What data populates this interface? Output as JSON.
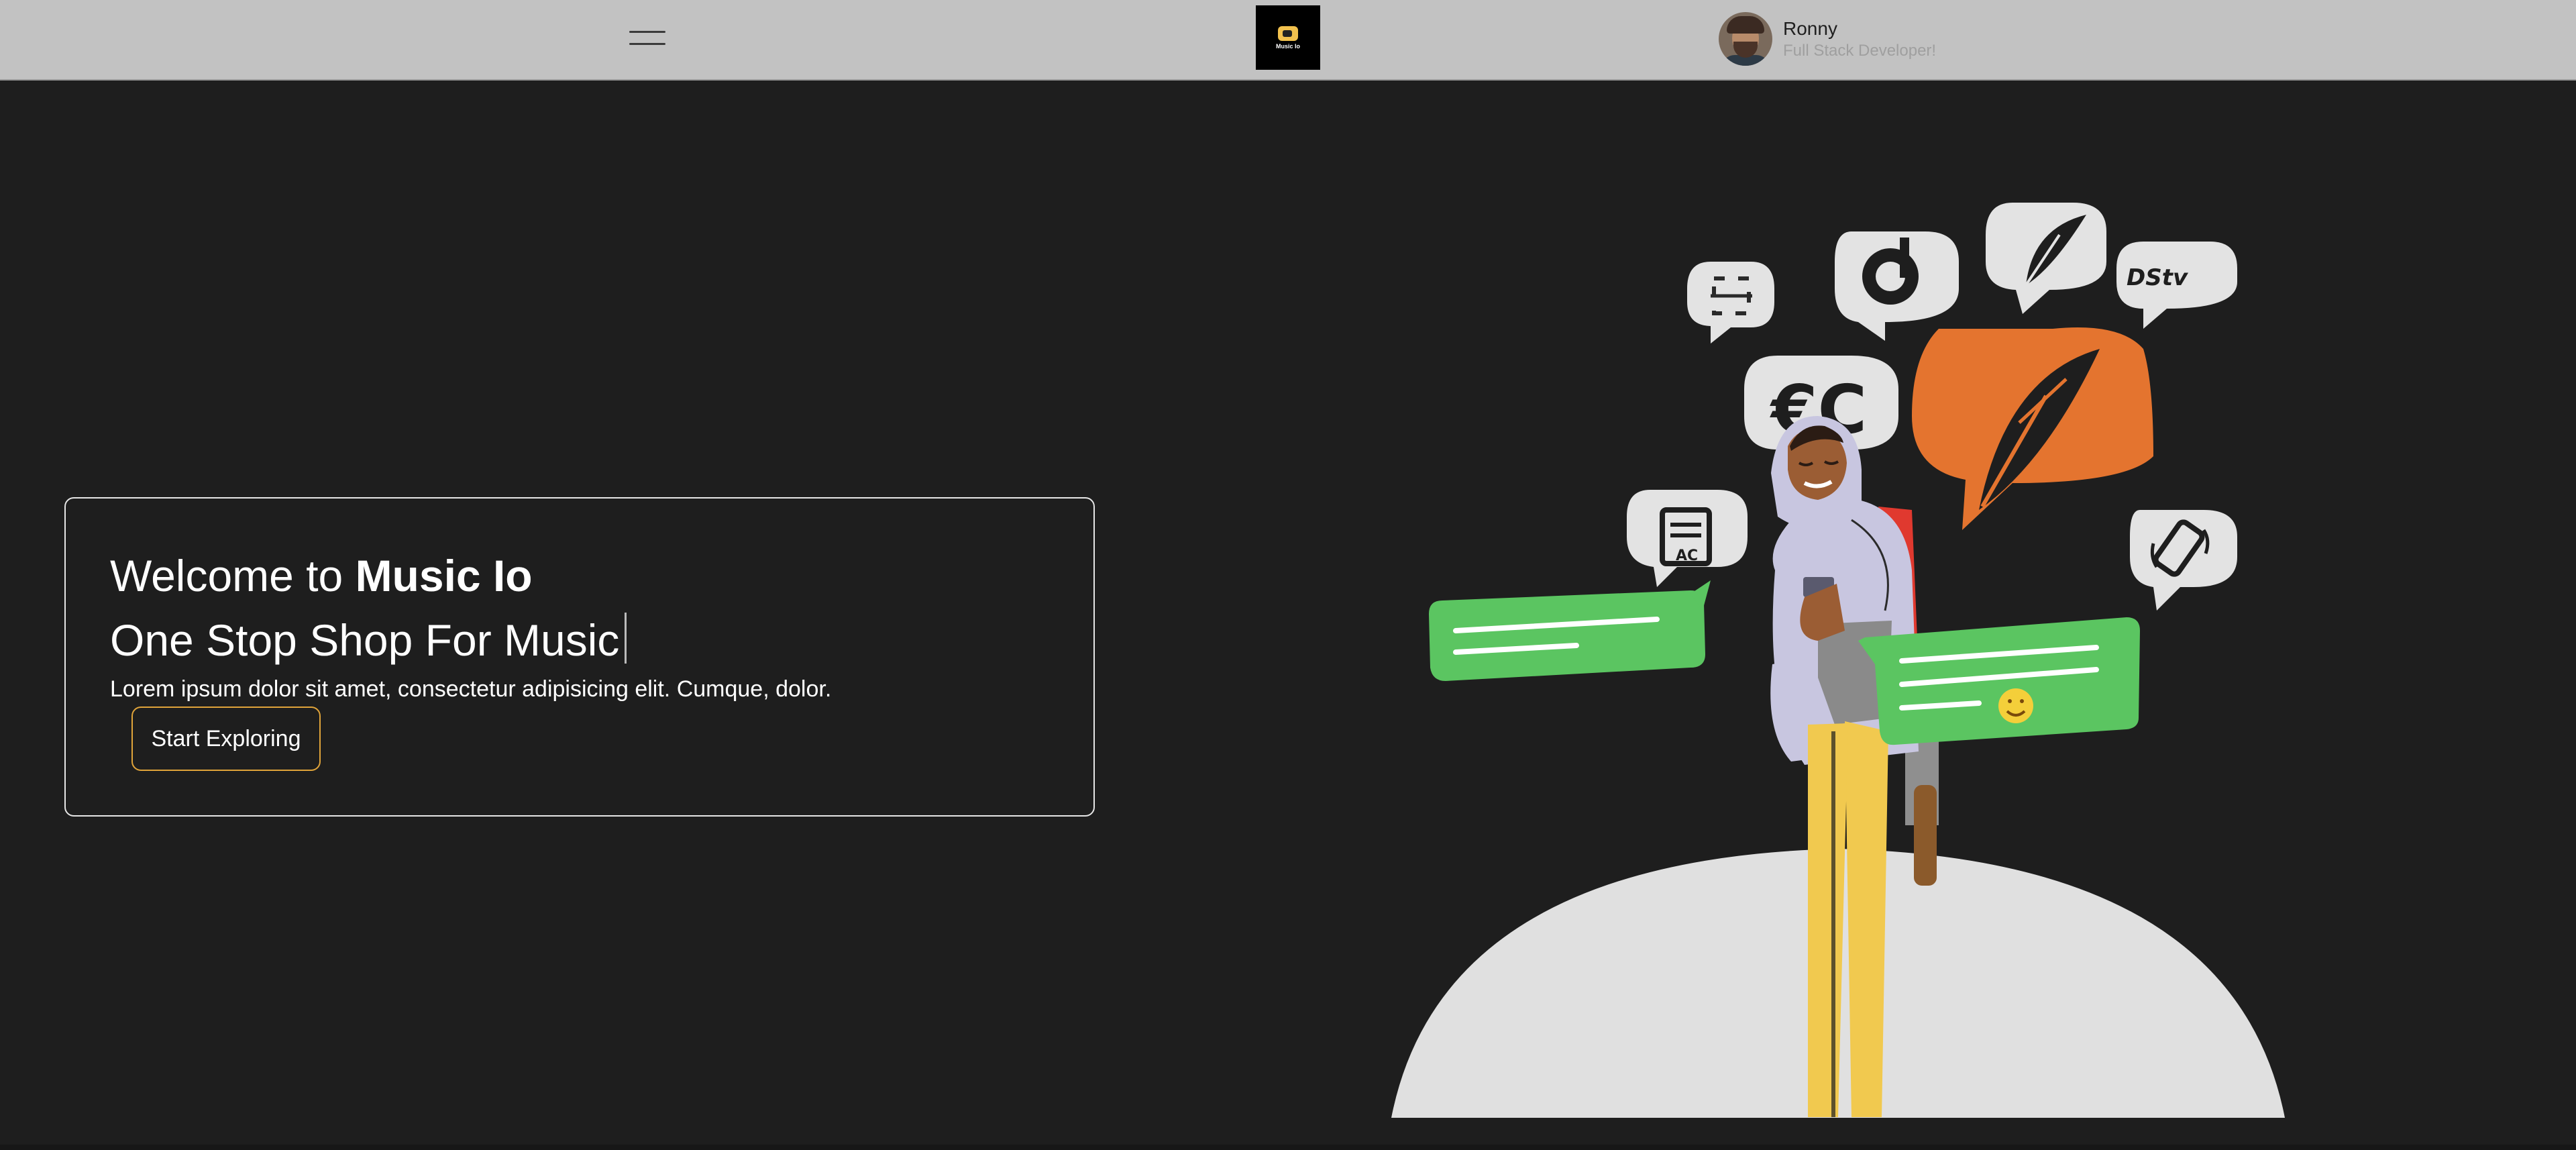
{
  "header": {
    "menu_icon": "hamburger-menu-icon",
    "logo": {
      "label": "Music Io",
      "icon": "music-chat-logo-icon"
    },
    "profile": {
      "name": "Ronny",
      "role": "Full Stack Developer!"
    }
  },
  "hero": {
    "welcome_prefix": "Welcome to ",
    "brand": "Music Io",
    "tagline": "One Stop Shop For Music",
    "description": "Lorem ipsum dolor sit amet, consectetur adipisicing elit. Cumque, dolor.",
    "cta_label": "Start Exploring"
  },
  "illustration": {
    "bubble_icons": [
      "scan-icon",
      "tiktok-icon",
      "quill-icon",
      "dstv-icon",
      "euro-icon",
      "document-icon",
      "phone-vibrate-icon",
      "quill-feather-icon"
    ],
    "emoji": "😊"
  },
  "colors": {
    "header_bg": "#c2c2c2",
    "page_bg": "#1e1e1e",
    "accent_orange": "#e4742f",
    "cta_border": "#e0a43a",
    "chat_green": "#5bc561",
    "pants_yellow": "#f1c94f",
    "hoodie_lavender": "#c8c6e0"
  }
}
